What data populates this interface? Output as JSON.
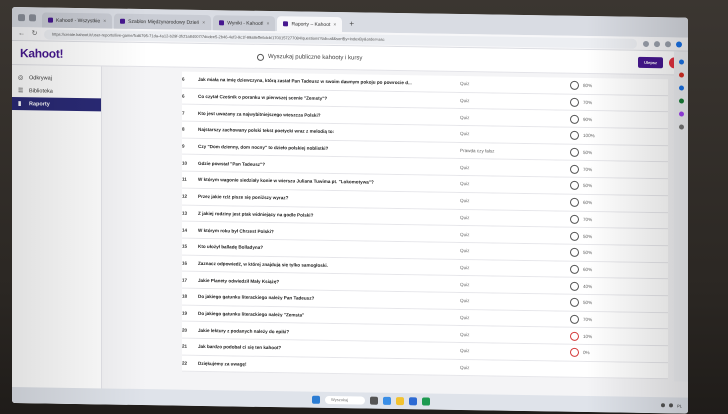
{
  "browser": {
    "tabs": [
      {
        "label": "Kahoot! - Wszystkie",
        "active": false
      },
      {
        "label": "Szablon Międzynarodowy Dzień",
        "active": false
      },
      {
        "label": "Wyniki - Kahoot!",
        "active": false
      },
      {
        "label": "Raporty – Kahoot",
        "active": true
      }
    ],
    "new_tab": "+",
    "url": "https://create.kahoot.it/user-reports/live-game/fcd6795-71da-4a12-b29f-3fcf1a84007/7dcdee5-2b46-4ef3-9c1f-99a8effe6dcb/1700157277084/questions?tab=all&sortBy=indexBy&order=asc"
  },
  "app": {
    "logo": "Kahoot!",
    "search_placeholder": "Wyszukaj publiczne kahooty i kursy",
    "upgrade_label": "Ulepsz"
  },
  "sidebar": {
    "items": [
      {
        "label": "Odkrywaj",
        "icon": "compass-icon",
        "active": false
      },
      {
        "label": "Biblioteka",
        "icon": "list-icon",
        "active": false
      },
      {
        "label": "Raporty",
        "icon": "bar-chart-icon",
        "active": true
      }
    ]
  },
  "questions": [
    {
      "num": "6",
      "q": "Jak miała na imię dziewczyna, którą zastał Pan Tadeusz w swoim dawnym pokoju po powrocie d...",
      "type": "Quiz",
      "pct": "80%",
      "ring": "dark"
    },
    {
      "num": "6",
      "q": "Co czytał Cześnik o poranku w pierwszej scenie \"Zemsty\"?",
      "type": "Quiz",
      "pct": "70%",
      "ring": "dark"
    },
    {
      "num": "7",
      "q": "Kto jest uważany za najwybitniejszego wieszcza Polski?",
      "type": "Quiz",
      "pct": "90%",
      "ring": "dark"
    },
    {
      "num": "8",
      "q": "Najstarszy zachowany polski tekst poetycki wraz z melodią to:",
      "type": "Quiz",
      "pct": "100%",
      "ring": "dark"
    },
    {
      "num": "9",
      "q": "Czy \"Dom dzienny, dom nocny\" to dzieło polskiej noblistki?",
      "type": "Prawda czy fałsz",
      "pct": "50%",
      "ring": "dark"
    },
    {
      "num": "10",
      "q": "Gdzie powstał \"Pan Tadeusz\"?",
      "type": "Quiz",
      "pct": "70%",
      "ring": "dark"
    },
    {
      "num": "11",
      "q": "W którym wagonie siedziały konie w wierszu Juliana Tuwima pt. \"Lokomotywa\"?",
      "type": "Quiz",
      "pct": "50%",
      "ring": "dark"
    },
    {
      "num": "12",
      "q": "Przez jakie rz/ż pisze się poniższy wyraz?",
      "type": "Quiz",
      "pct": "60%",
      "ring": "dark"
    },
    {
      "num": "13",
      "q": "Z jakiej rodziny jest ptak widniejący na godle Polski?",
      "type": "Quiz",
      "pct": "70%",
      "ring": "dark"
    },
    {
      "num": "14",
      "q": "W którym roku był Chrzest Polski?",
      "type": "Quiz",
      "pct": "50%",
      "ring": "dark"
    },
    {
      "num": "15",
      "q": "Kto ułożył balladę Bolladyna?",
      "type": "Quiz",
      "pct": "50%",
      "ring": "dark"
    },
    {
      "num": "16",
      "q": "Zaznacz odpowiedź, w której znajdują się tylko samogłoski.",
      "type": "Quiz",
      "pct": "60%",
      "ring": "dark"
    },
    {
      "num": "17",
      "q": "Jakie Planety odwiedził Mały Książę?",
      "type": "Quiz",
      "pct": "40%",
      "ring": "dark"
    },
    {
      "num": "18",
      "q": "Do jakiego gatunku literackiego należy Pan Tadeusz?",
      "type": "Quiz",
      "pct": "50%",
      "ring": "dark"
    },
    {
      "num": "19",
      "q": "Do jakiego gatunku literackiego należy \"Zemsta\"",
      "type": "Quiz",
      "pct": "70%",
      "ring": "dark"
    },
    {
      "num": "20",
      "q": "Jakie lektury z podanych należy do epiki?",
      "type": "Quiz",
      "pct": "10%",
      "ring": "red"
    },
    {
      "num": "21",
      "q": "Jak bardzo podobał ci się ten kahoot?",
      "type": "Quiz",
      "pct": "0%",
      "ring": "red"
    },
    {
      "num": "22",
      "q": "Dziękujemy za uwagę!",
      "type": "Quiz",
      "pct": "",
      "ring": "none"
    }
  ],
  "taskbar": {
    "search_label": "Wyszukaj",
    "tray": "PL"
  },
  "colors": {
    "brand": "#46178f",
    "active_nav": "#2a2a76",
    "danger": "#d43b3b"
  }
}
